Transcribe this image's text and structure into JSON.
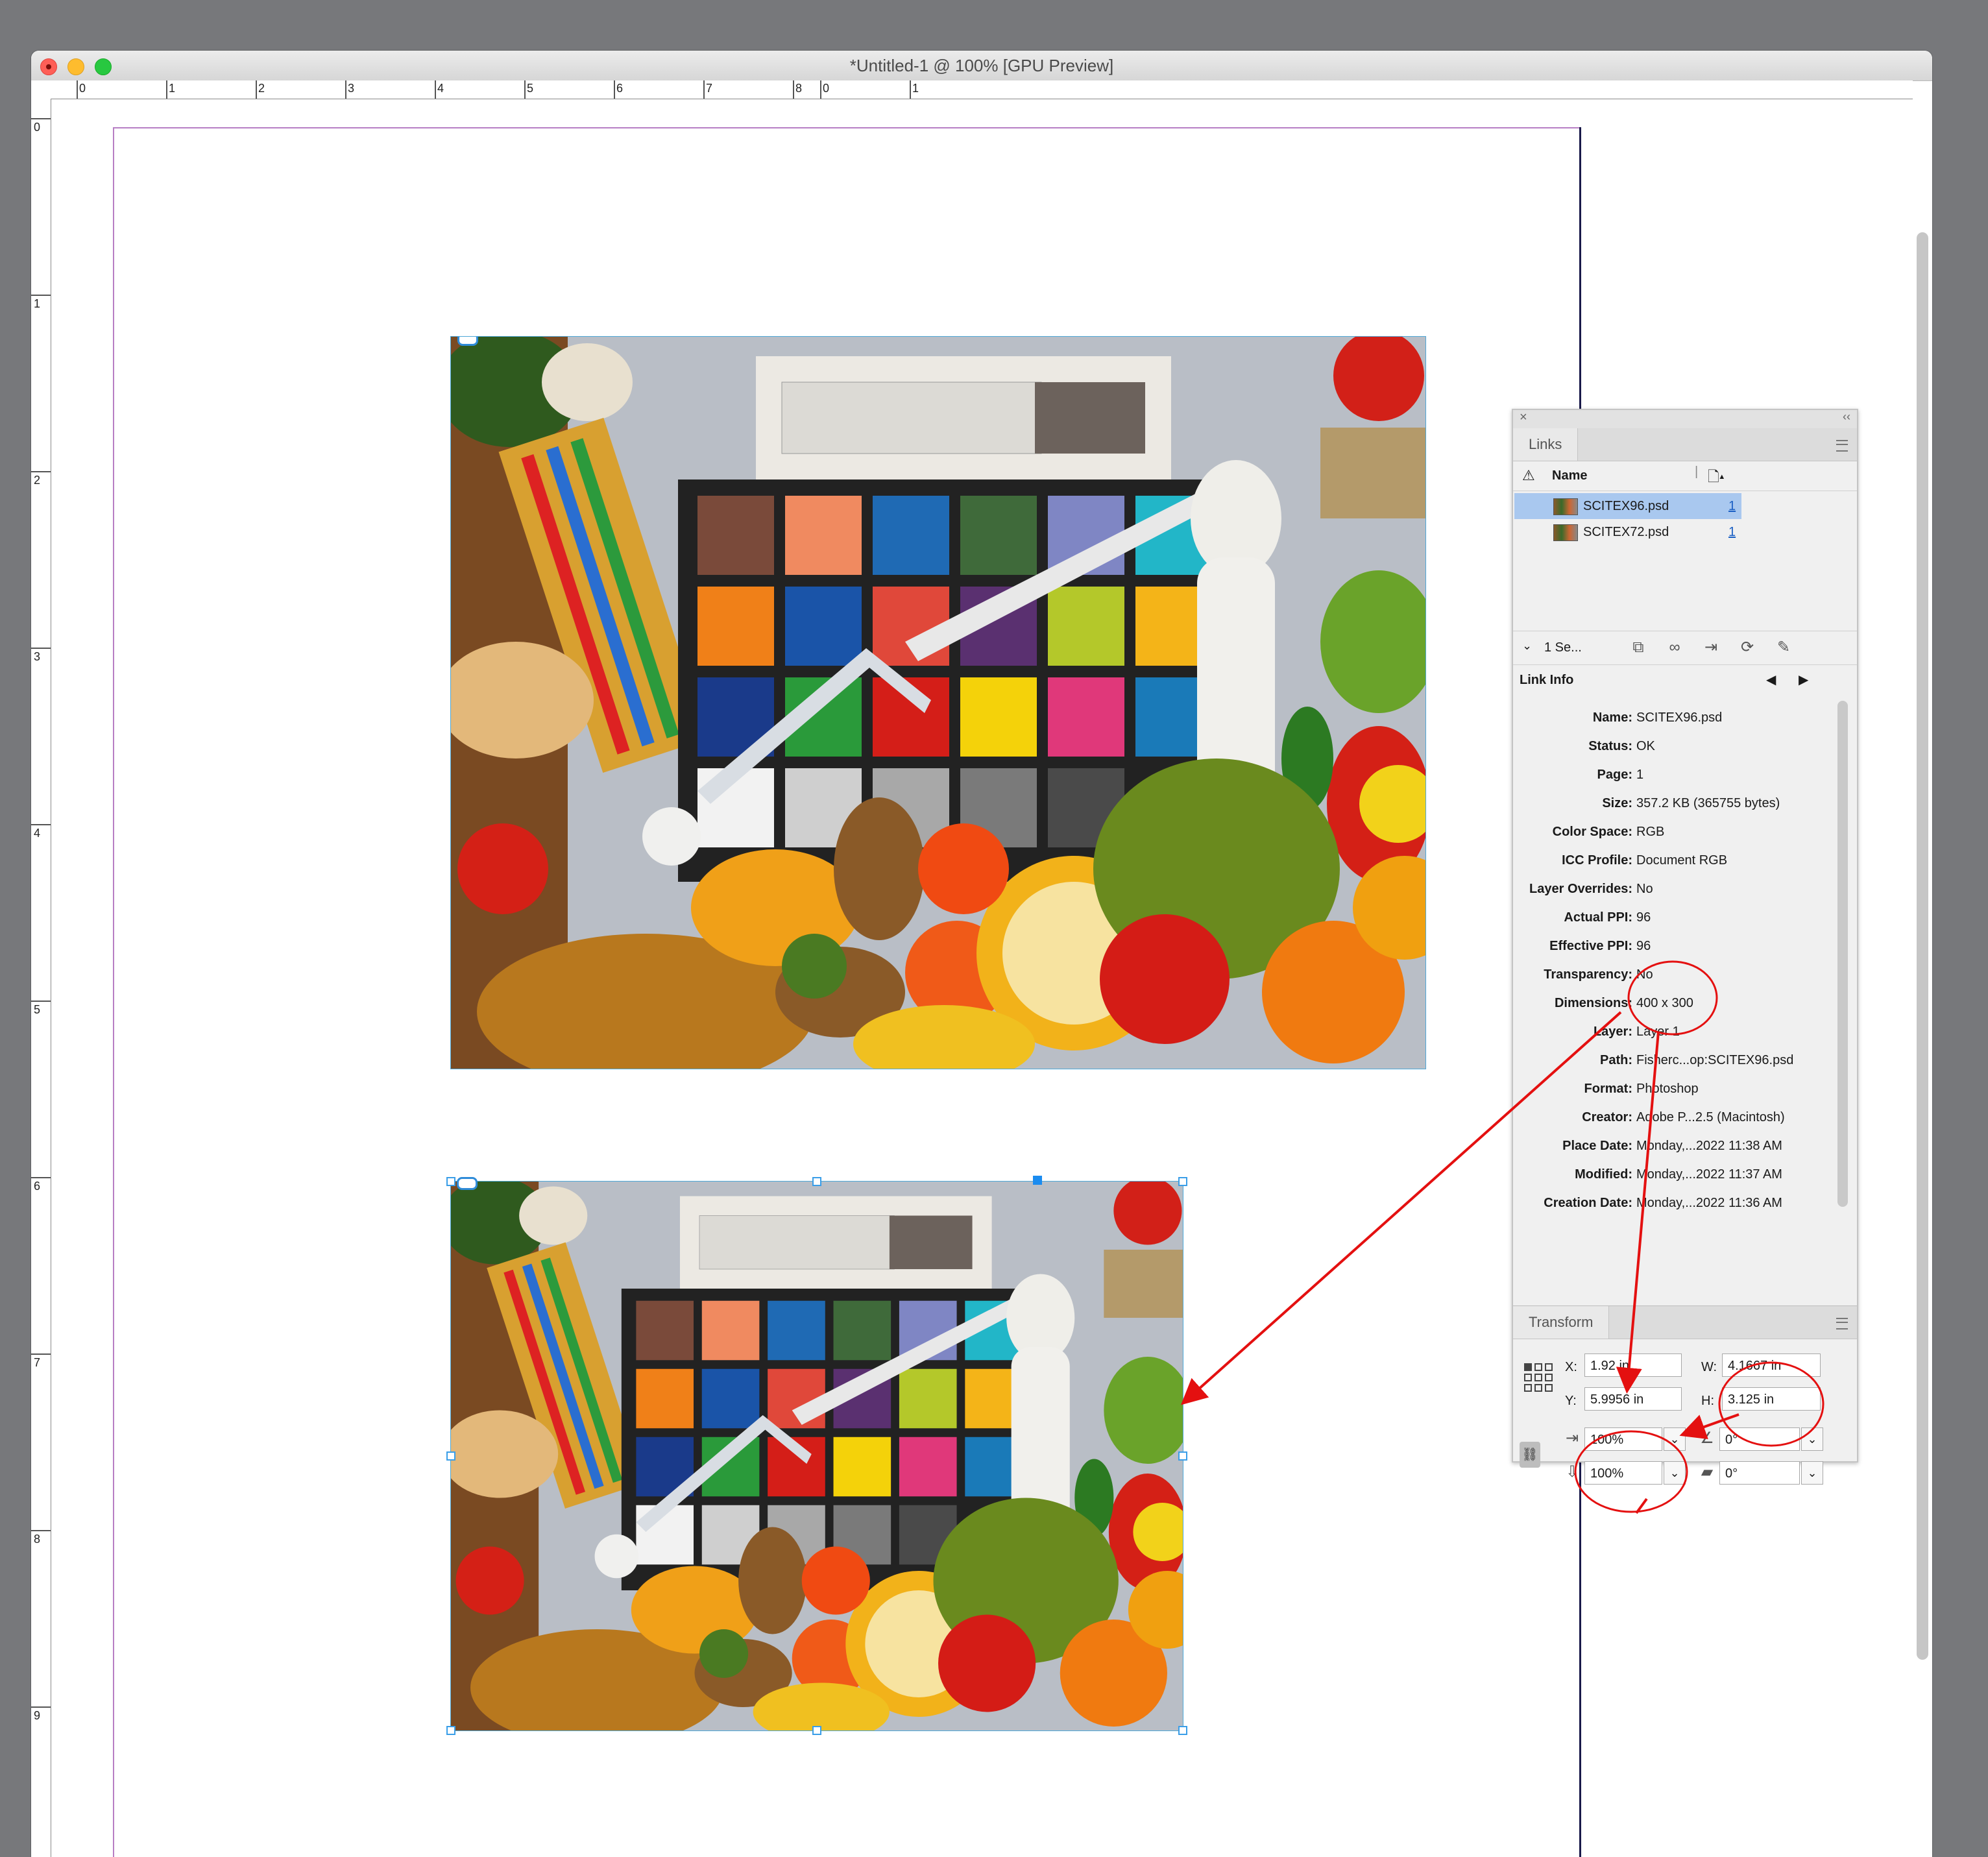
{
  "window": {
    "title": "*Untitled-1 @ 100% [GPU Preview]"
  },
  "rulers": {
    "horizontal": [
      "0",
      "1",
      "2",
      "3",
      "4",
      "5",
      "6",
      "7",
      "8",
      "0",
      "1"
    ],
    "vertical": [
      "0",
      "1",
      "2",
      "3",
      "4",
      "5",
      "6",
      "7",
      "8",
      "9"
    ]
  },
  "links_panel": {
    "tab": "Links",
    "column_name": "Name",
    "items": [
      {
        "name": "SCITEX96.psd",
        "page": "1",
        "selected": true
      },
      {
        "name": "SCITEX72.psd",
        "page": "1",
        "selected": false
      }
    ],
    "selection_count": "1 Se...",
    "link_info_title": "Link Info",
    "info": [
      {
        "label": "Name:",
        "value": "SCITEX96.psd"
      },
      {
        "label": "Status:",
        "value": "OK"
      },
      {
        "label": "Page:",
        "value": "1"
      },
      {
        "label": "Size:",
        "value": "357.2 KB (365755 bytes)"
      },
      {
        "label": "Color Space:",
        "value": "RGB"
      },
      {
        "label": "ICC Profile:",
        "value": "Document RGB"
      },
      {
        "label": "Layer Overrides:",
        "value": "No"
      },
      {
        "label": "Actual PPI:",
        "value": "96"
      },
      {
        "label": "Effective PPI:",
        "value": "96"
      },
      {
        "label": "Transparency:",
        "value": "No"
      },
      {
        "label": "Dimensions:",
        "value": "400 x 300"
      },
      {
        "label": "Layer:",
        "value": "Layer 1"
      },
      {
        "label": "Path:",
        "value": "Fisherc...op:SCITEX96.psd"
      },
      {
        "label": "Format:",
        "value": "Photoshop"
      },
      {
        "label": "Creator:",
        "value": "Adobe P...2.5 (Macintosh)"
      },
      {
        "label": "Place Date:",
        "value": "Monday,...2022 11:38 AM"
      },
      {
        "label": "Modified:",
        "value": "Monday,...2022 11:37 AM"
      },
      {
        "label": "Creation Date:",
        "value": "Monday,...2022 11:36 AM"
      }
    ]
  },
  "transform_panel": {
    "tab": "Transform",
    "x_label": "X:",
    "x_value": "1.92 in",
    "y_label": "Y:",
    "y_value": "5.9956 in",
    "w_label": "W:",
    "w_value": "4.1667 in",
    "h_label": "H:",
    "h_value": "3.125 in",
    "scale_x": "100%",
    "scale_y": "100%",
    "rotation": "0°",
    "shear": "0°"
  },
  "colors": {
    "selection_blue": "#3a9ee8",
    "annotation_red": "#e41010",
    "frame_magenta": "#b77ec4"
  }
}
